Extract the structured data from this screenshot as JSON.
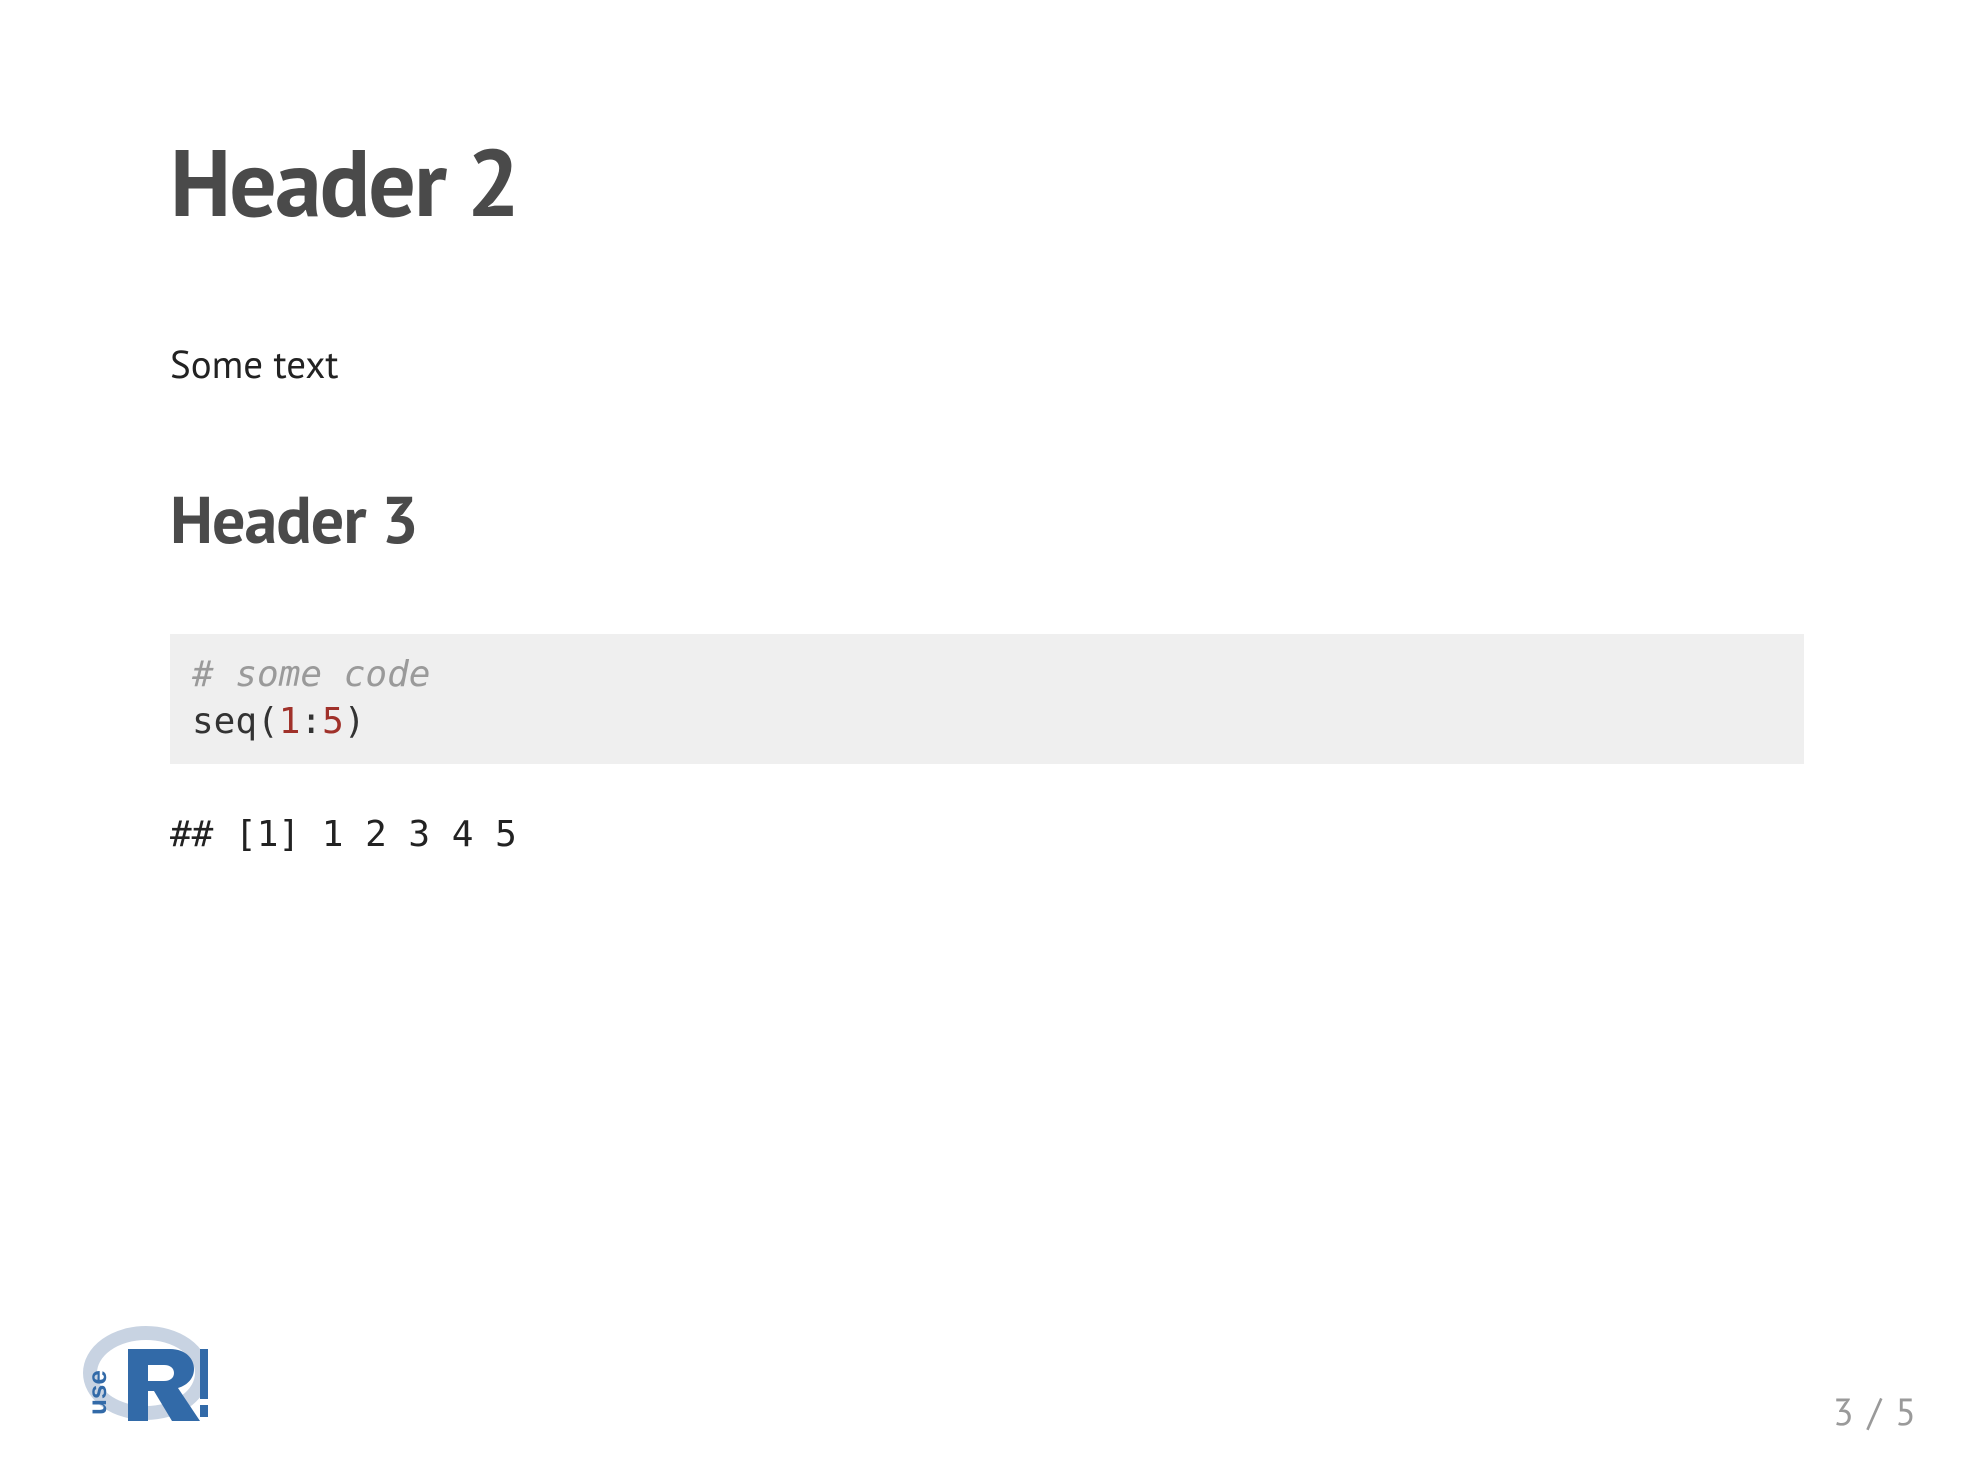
{
  "slide": {
    "header2": "Header 2",
    "body_text": "Some text",
    "header3": "Header 3",
    "code": {
      "comment": "# some code",
      "fn": "seq",
      "open": "(",
      "num1": "1",
      "colon": ":",
      "num2": "5",
      "close": ")"
    },
    "output": "## [1] 1 2 3 4 5",
    "page_number": "3 / 5",
    "logo_alt": "useR!"
  }
}
